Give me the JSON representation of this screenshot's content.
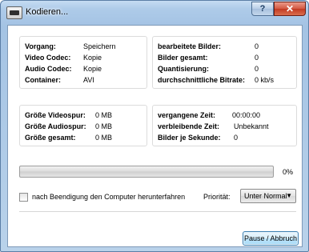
{
  "window": {
    "title": "Kodieren...",
    "help_label": "?",
    "close_label": "✕"
  },
  "info": {
    "process_label": "Vorgang:",
    "process_value": "Speichern",
    "video_codec_label": "Video Codec:",
    "video_codec_value": "Kopie",
    "audio_codec_label": "Audio Codec:",
    "audio_codec_value": "Kopie",
    "container_label": "Container:",
    "container_value": "AVI"
  },
  "frames": {
    "processed_label": "bearbeitete Bilder:",
    "processed_value": "0",
    "total_label": "Bilder gesamt:",
    "total_value": "0",
    "quant_label": "Quantisierung:",
    "quant_value": "0",
    "bitrate_label": "durchschnittliche Bitrate:",
    "bitrate_value": "0 kb/s"
  },
  "sizes": {
    "video_label": "Größe Videospur:",
    "video_value": "0 MB",
    "audio_label": "Größe Audiospur:",
    "audio_value": "0 MB",
    "total_label": "Größe gesamt:",
    "total_value": "0 MB"
  },
  "time": {
    "elapsed_label": "vergangene Zeit:",
    "elapsed_value": "00:00:00",
    "remaining_label": "verbleibende Zeit:",
    "remaining_value": "Unbekannt",
    "fps_label": "Bilder je Sekunde:",
    "fps_value": "0"
  },
  "progress": {
    "percent": 0,
    "percent_label": "0%"
  },
  "options": {
    "shutdown_label": "nach Beendigung den Computer herunterfahren",
    "shutdown_checked": false,
    "priority_label": "Priorität:",
    "priority_value": "Unter Normal"
  },
  "actions": {
    "pause_abort_label": "Pause / Abbruch"
  },
  "colors": {
    "progress_fill": "#29c535",
    "close_button": "#c23a22"
  }
}
